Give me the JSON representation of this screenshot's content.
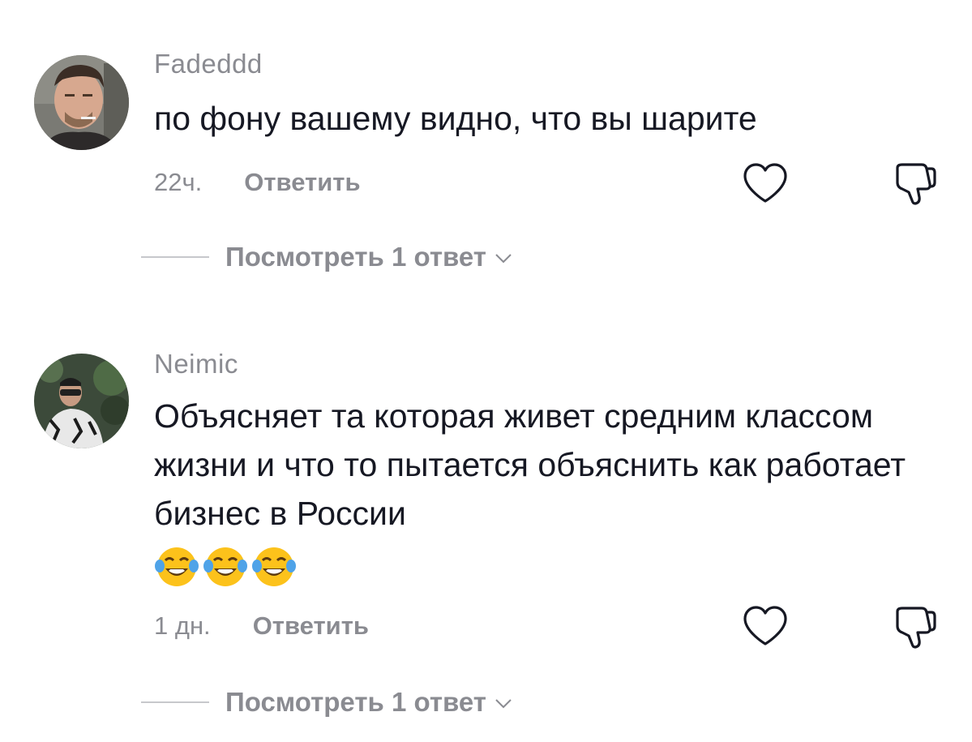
{
  "comments": [
    {
      "username": "Fadeddd",
      "text": "по фону вашему видно, что вы шарите",
      "emojis": [],
      "time": "22ч.",
      "reply_label": "Ответить",
      "view_replies_label": "Посмотреть 1 ответ"
    },
    {
      "username": "Neimic",
      "text": "Объясняет та которая живет средним классом жизни и что то пытается объяснить как работает бизнес в России",
      "emojis": [
        "face-with-tears-of-joy",
        "face-with-tears-of-joy",
        "face-with-tears-of-joy"
      ],
      "time": "1 дн.",
      "reply_label": "Ответить",
      "view_replies_label": "Посмотреть 1 ответ"
    }
  ],
  "icons": {
    "like": "heart-outline-icon",
    "dislike": "thumbs-down-outline-icon",
    "expand": "chevron-down-icon"
  },
  "colors": {
    "text": "#161823",
    "muted": "#8a8b91",
    "divider": "#c7c8cc",
    "background": "#ffffff"
  }
}
